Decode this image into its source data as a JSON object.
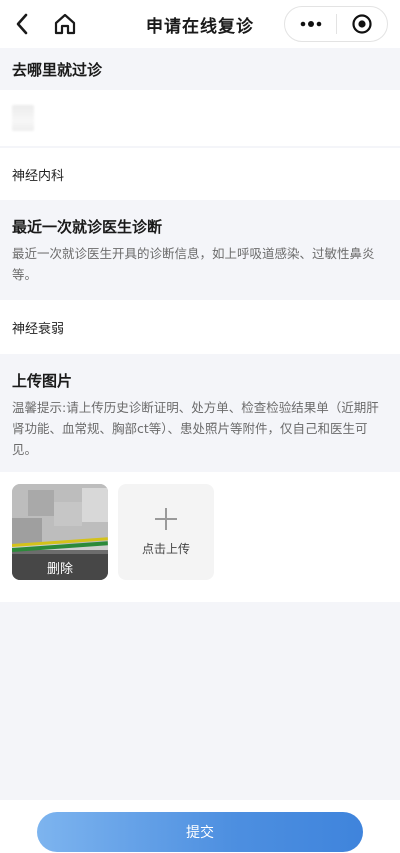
{
  "header": {
    "title": "申请在线复诊"
  },
  "sections": {
    "where": {
      "title": "去哪里就过诊",
      "hospital_value": "",
      "department_value": "神经内科"
    },
    "diagnosis": {
      "title": "最近一次就诊医生诊断",
      "desc": "最近一次就诊医生开具的诊断信息，如上呼吸道感染、过敏性鼻炎等。",
      "value": "神经衰弱"
    },
    "upload": {
      "title": "上传图片",
      "desc": "温馨提示:请上传历史诊断证明、处方单、检查检验结果单（近期肝肾功能、血常规、胸部ct等）、患处照片等附件，仅自己和医生可见。",
      "delete_label": "删除",
      "upload_label": "点击上传"
    }
  },
  "submit_label": "提交"
}
